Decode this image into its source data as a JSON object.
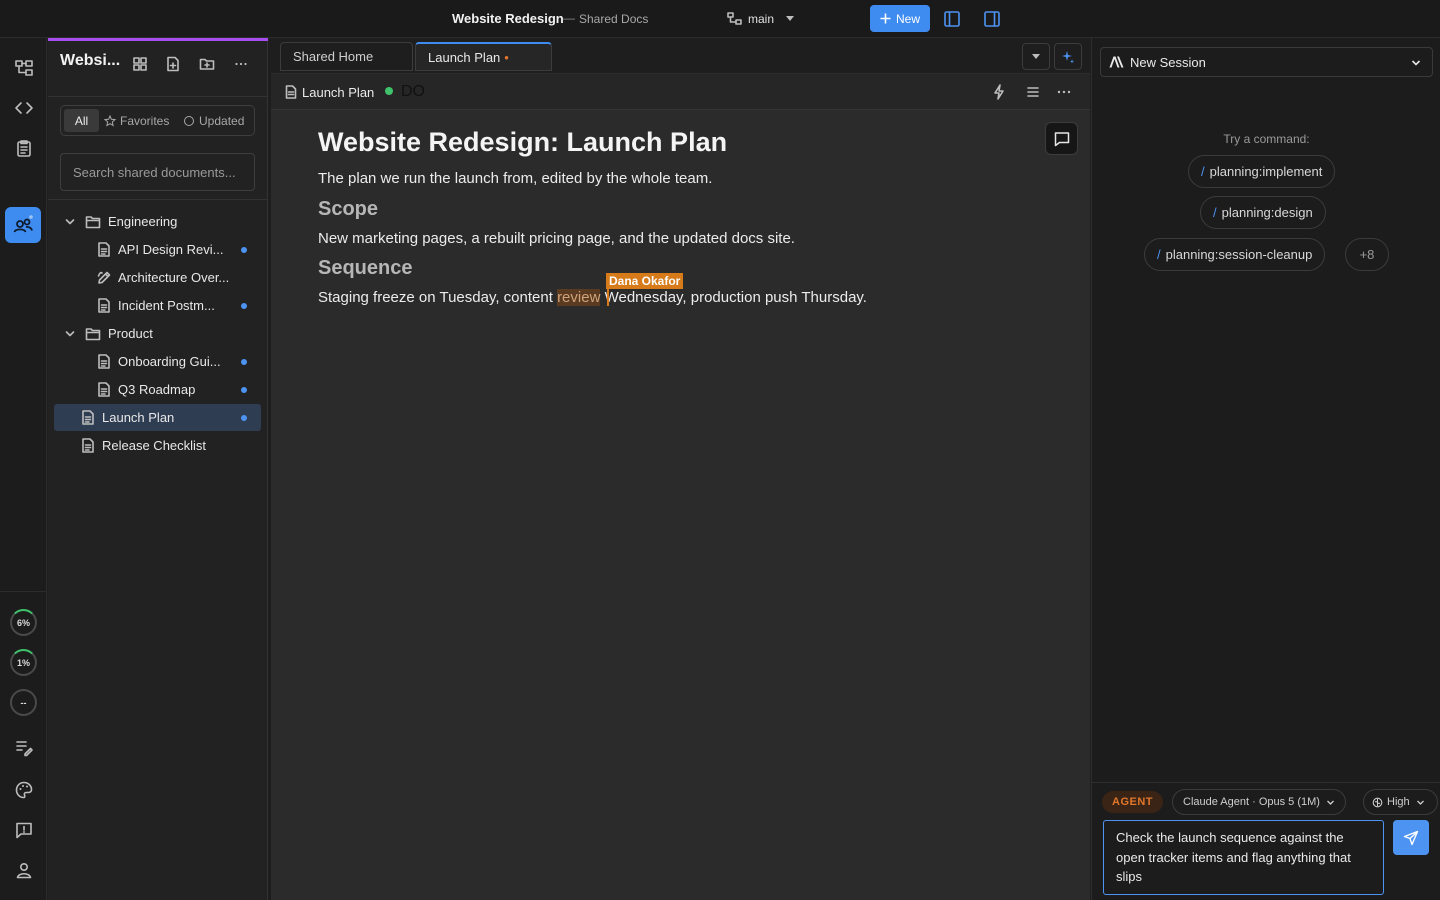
{
  "topbar": {
    "project_title": "Website Redesign",
    "separator": "—",
    "project_subtitle": "Shared Docs",
    "branch": "main",
    "new_label": "New"
  },
  "activity": {
    "gauges": [
      "6%",
      "1%",
      "--"
    ]
  },
  "sidebar": {
    "workspace_name": "Websi...",
    "filters": {
      "all": "All",
      "favorites": "Favorites",
      "updated": "Updated"
    },
    "search_placeholder": "Search shared documents...",
    "tree": [
      {
        "label": "Engineering",
        "type": "folder"
      },
      {
        "label": "API Design Revi...",
        "type": "doc",
        "unread": true
      },
      {
        "label": "Architecture Over...",
        "type": "drawing",
        "unread": false
      },
      {
        "label": "Incident Postm...",
        "type": "doc",
        "unread": true
      },
      {
        "label": "Product",
        "type": "folder"
      },
      {
        "label": "Onboarding Gui...",
        "type": "doc",
        "unread": true
      },
      {
        "label": "Q3 Roadmap",
        "type": "doc",
        "unread": true
      },
      {
        "label": "Launch Plan",
        "type": "doc",
        "unread": true,
        "selected": true
      },
      {
        "label": "Release Checklist",
        "type": "doc",
        "unread": false
      }
    ]
  },
  "tabs": [
    {
      "label": "Shared Home"
    },
    {
      "label": "Launch Plan",
      "modified_marker": "•"
    }
  ],
  "crumb": {
    "label": "Launch Plan",
    "status_text": "DO"
  },
  "document": {
    "title": "Website Redesign: Launch Plan",
    "intro": "The plan we run the launch from, edited by the whole team.",
    "h_scope": "Scope",
    "scope_text": "New marketing pages, a rebuilt pricing page, and the updated docs site.",
    "h_sequence": "Sequence",
    "seq_before": "Staging freeze on Tuesday, content ",
    "seq_highlight": "review",
    "seq_after": " Wednesday, production push Thursday.",
    "collaborator_cursor": "Dana Okafor"
  },
  "rpanel": {
    "session_label": "New Session",
    "try_label": "Try a command:",
    "commands": [
      "planning:implement",
      "planning:design",
      "planning:session-cleanup"
    ],
    "more_label": "+8",
    "agent_badge": "AGENT",
    "model_label": "Claude Agent · Opus 5 (1M)",
    "effort_label": "High",
    "prompt_value": "Check the launch sequence against the open tracker items and flag anything that slips"
  },
  "colors": {
    "accent": "#3f8cf0",
    "sidebar_accent": "#a84ef0",
    "collaborator": "#d67a1a",
    "status_online": "#3fc26b",
    "agent": "#e2762a"
  }
}
